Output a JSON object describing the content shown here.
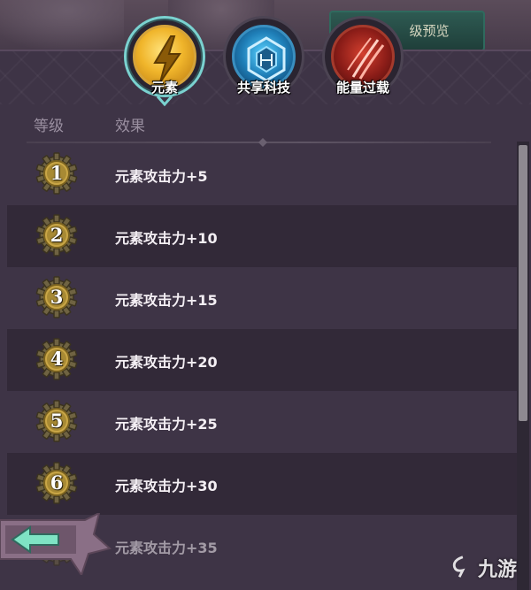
{
  "top": {
    "preview_button_label": "级预览"
  },
  "tabs": [
    {
      "label": "元素",
      "icon": "lightning-icon",
      "selected": true
    },
    {
      "label": "共享科技",
      "icon": "circuit-hexagon-icon",
      "selected": false
    },
    {
      "label": "能量过载",
      "icon": "claw-slash-icon",
      "selected": false
    }
  ],
  "table": {
    "headers": {
      "level": "等级",
      "effect": "效果"
    },
    "rows": [
      {
        "level": "1",
        "effect": "元素攻击力+5"
      },
      {
        "level": "2",
        "effect": "元素攻击力+10"
      },
      {
        "level": "3",
        "effect": "元素攻击力+15"
      },
      {
        "level": "4",
        "effect": "元素攻击力+20"
      },
      {
        "level": "5",
        "effect": "元素攻击力+25"
      },
      {
        "level": "6",
        "effect": "元素攻击力+30"
      },
      {
        "level": "",
        "effect": "元素攻击力+35"
      }
    ]
  },
  "watermark": {
    "text": "九游"
  },
  "colors": {
    "accent_teal": "#7ad2d0",
    "badge_gold": "#c9a646",
    "back_arrow_green": "#7fe3c4"
  }
}
